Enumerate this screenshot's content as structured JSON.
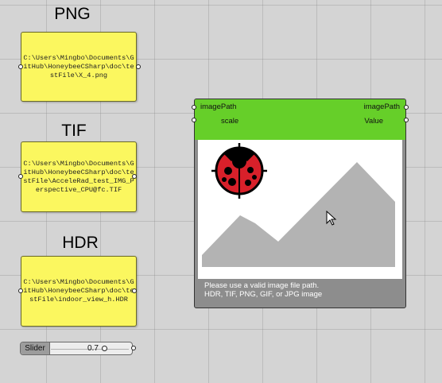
{
  "panels": [
    {
      "title": "PNG",
      "path": "C:\\Users\\Mingbo\\Documents\\GitHub\\HoneybeeCSharp\\doc\\testFile\\X_4.png"
    },
    {
      "title": "TIF",
      "path": "C:\\Users\\Mingbo\\Documents\\GitHub\\HoneybeeCSharp\\doc\\testFile\\AcceleRad_test_IMG_Perspective_CPU@fc.TIF"
    },
    {
      "title": "HDR",
      "path": "C:\\Users\\Mingbo\\Documents\\GitHub\\HoneybeeCSharp\\doc\\testFile\\indoor_view_h.HDR"
    }
  ],
  "slider": {
    "label": "Slider",
    "value": "0.7",
    "fraction": 0.7
  },
  "component": {
    "inputs": [
      "imagePath",
      "scale"
    ],
    "outputs": [
      "imagePath",
      "Value"
    ],
    "icon": "ladybug-icon",
    "placeholder": "mountain-image-placeholder",
    "message_line1": "Please use a valid image file path.",
    "message_line2": "HDR, TIF, PNG, GIF, or JPG image"
  },
  "colors": {
    "panel": "#fbf75f",
    "component_header": "#66cf29",
    "ladybug_red": "#d8202a"
  },
  "cursor": "mouse-pointer-icon"
}
